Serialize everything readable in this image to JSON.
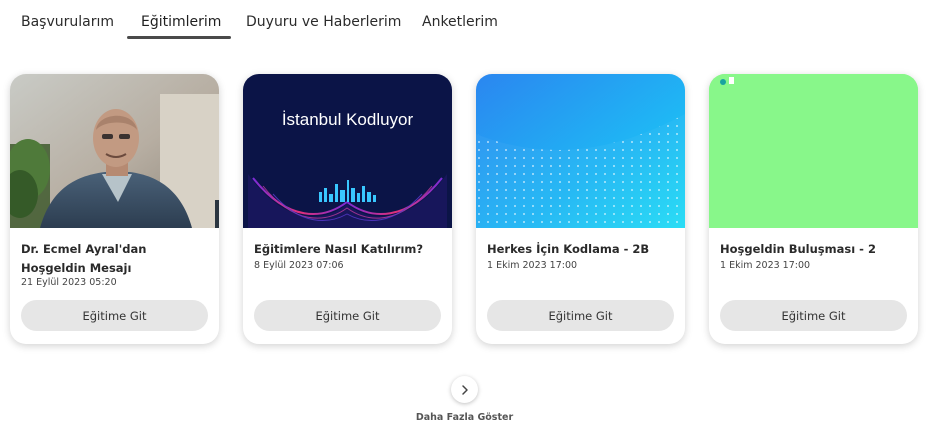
{
  "tabs": [
    {
      "label": "Başvurularım",
      "active": false
    },
    {
      "label": "Eğitimlerim",
      "active": true
    },
    {
      "label": "Duyuru ve Haberlerim",
      "active": false
    },
    {
      "label": "Anketlerim",
      "active": false
    }
  ],
  "cards": [
    {
      "title": "Dr. Ecmel Ayral'dan Hoşgeldin Mesajı",
      "date": "21 Eylül 2023 05:20",
      "button": "Eğitime Git",
      "thumb": "photo-man-in-suit"
    },
    {
      "title": "Eğitimlere Nasıl Katılırım?",
      "date": "8 Eylül 2023 07:06",
      "button": "Eğitime Git",
      "thumb": "istanbul-kodluyor-banner",
      "thumb_text": "İstanbul Kodluyor"
    },
    {
      "title": "Herkes İçin Kodlama - 2B",
      "date": "1 Ekim 2023 17:00",
      "button": "Eğitime Git",
      "thumb": "blue-gradient-digits"
    },
    {
      "title": "Hoşgeldin Buluşması - 2",
      "date": "1 Ekim 2023 17:00",
      "button": "Eğitime Git",
      "thumb": "solid-green"
    }
  ],
  "more": {
    "label": "Daha Fazla Göster",
    "icon": "chevron-right-icon"
  },
  "colors": {
    "green_thumb": "#88f78a",
    "navy_thumb": "#0b1447",
    "blue_start": "#2aa3f0",
    "blue_end": "#20d4f5"
  }
}
